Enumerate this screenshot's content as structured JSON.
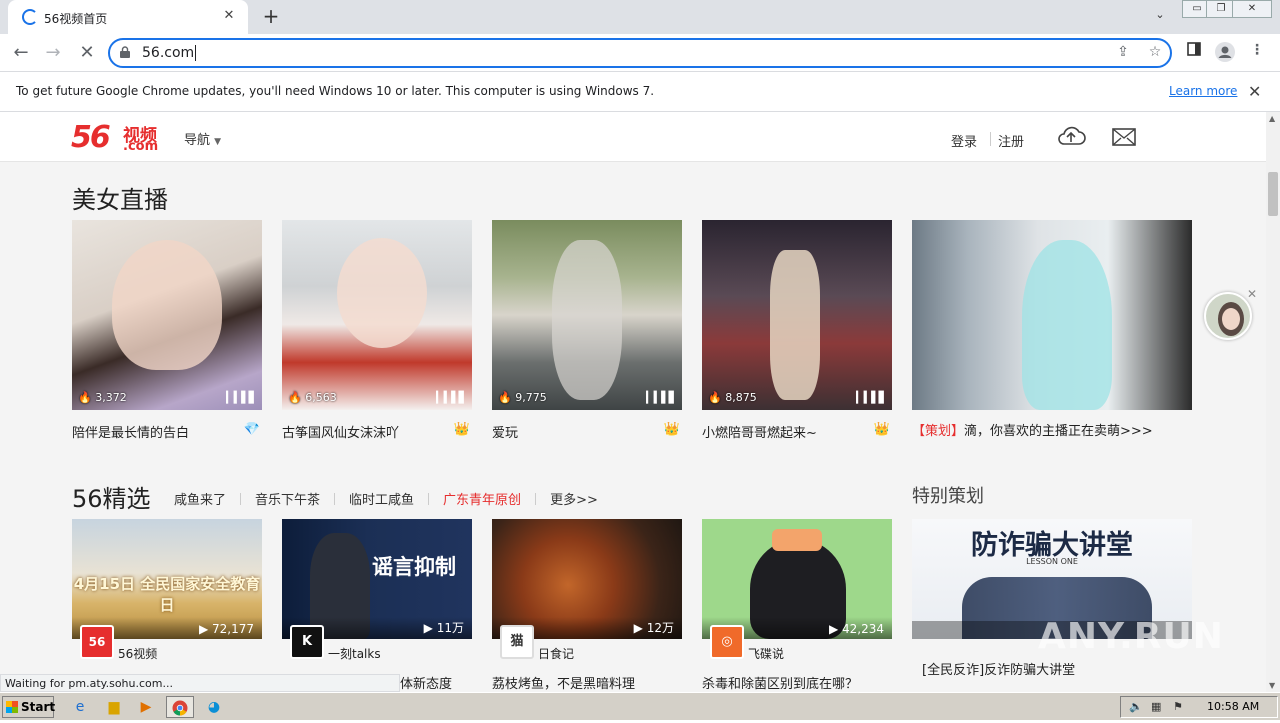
{
  "browser": {
    "tab_title": "56视频首页",
    "url": "56.com",
    "info_message": "To get future Google Chrome updates, you'll need Windows 10 or later. This computer is using Windows 7.",
    "learn_more": "Learn more",
    "status_text": "Waiting for pm.aty.sohu.com..."
  },
  "site": {
    "logo_num": "56",
    "logo_cn": "视频",
    "logo_com": ".com",
    "nav_label": "导航",
    "login": "登录",
    "register": "注册"
  },
  "live": {
    "title": "美女直播",
    "cards": [
      {
        "count": "3,372",
        "caption": "陪伴是最长情的告白",
        "badge": "💎"
      },
      {
        "count": "6,563",
        "caption": "古筝国风仙女沫沫吖",
        "badge": "👑"
      },
      {
        "count": "9,775",
        "caption": "爱玩",
        "badge": "👑"
      },
      {
        "count": "8,875",
        "caption": "小燃陪哥哥燃起来~",
        "badge": "👑"
      }
    ],
    "promo_tag": "【策划】",
    "promo_text": "滴，你喜欢的主播正在卖萌>>>"
  },
  "picks": {
    "title": "56精选",
    "subnav": [
      "咸鱼来了",
      "音乐下午茶",
      "临时工咸鱼",
      "广东青年原创",
      "更多>>"
    ],
    "videos": [
      {
        "views": "72,177",
        "channel": "56视频",
        "avatar": "56",
        "caption": "",
        "thumb_text": "4月15日 全民国家安全教育日"
      },
      {
        "views": "11万",
        "channel": "一刻talks",
        "avatar": "K",
        "caption": "体新态度",
        "thumb_text": "谣言抑制"
      },
      {
        "views": "12万",
        "channel": "日食记",
        "avatar": "猫",
        "caption": "荔枝烤鱼，不是黑暗料理",
        "thumb_text": ""
      },
      {
        "views": "42,234",
        "channel": "飞碟说",
        "avatar": "◎",
        "caption": "杀毒和除菌区别到底在哪？",
        "thumb_text": ""
      }
    ]
  },
  "special": {
    "title": "特别策划",
    "thumb_text": "防诈骗大讲堂",
    "thumb_sub": "LESSON ONE",
    "caption": "[全民反诈]反诈防骗大讲堂"
  },
  "watermark": "ANY.RUN",
  "taskbar": {
    "start": "Start",
    "clock": "10:58 AM"
  }
}
